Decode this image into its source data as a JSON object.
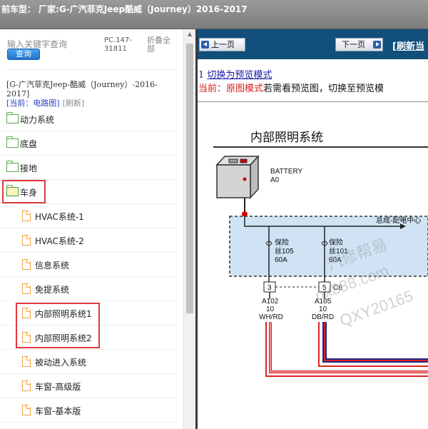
{
  "header": {
    "title": "前车型：  厂家:G-广汽菲克Jeep酷威（Journey）2016-2017"
  },
  "sidebar": {
    "search_placeholder": "输入关键字查询",
    "search_button": "查询",
    "pc_code": "PC.147-31811",
    "collapse_all": "折叠全部",
    "vehicle": "[G-广汽菲克Jeep-酷威（Journey）-2016-2017]",
    "current_label": "[当前：电路图]",
    "refresh_label": "[刷新]",
    "items": [
      {
        "label": "动力系统",
        "type": "folder"
      },
      {
        "label": "底盘",
        "type": "folder"
      },
      {
        "label": "接地",
        "type": "folder"
      },
      {
        "label": "车身",
        "type": "folder-open"
      },
      {
        "label": "HVAC系统-1",
        "type": "doc"
      },
      {
        "label": "HVAC系统-2",
        "type": "doc"
      },
      {
        "label": "信息系统",
        "type": "doc"
      },
      {
        "label": "免提系统",
        "type": "doc"
      },
      {
        "label": "内部照明系统1",
        "type": "doc"
      },
      {
        "label": "内部照明系统2",
        "type": "doc"
      },
      {
        "label": "被动进入系统",
        "type": "doc"
      },
      {
        "label": "车窗-高级版",
        "type": "doc"
      },
      {
        "label": "车窗-基本版",
        "type": "doc"
      }
    ]
  },
  "viewer": {
    "prev_button": "上一页",
    "next_button": "下一页",
    "refresh_link": "[刷新当",
    "switch_prefix": "1 ",
    "switch_link": "切换为预览模式",
    "mode_current": "当前：原图模式",
    "mode_hint": "若需看预览图，切换至预览模",
    "diagram": {
      "title": "内部照明系统",
      "battery_label": "BATTERY",
      "battery_code": "A0",
      "pdc_label": "总成-配电中心",
      "fuse1_line1": "保险",
      "fuse1_line2": "丝105",
      "fuse1_amp": "60A",
      "fuse2_line1": "保险",
      "fuse2_line2": "丝101",
      "fuse2_amp": "60A",
      "pin1": "3",
      "pin2": "5",
      "connector": "C6",
      "wire1_code": "A102",
      "wire1_gauge": "10",
      "wire1_color": "WH/RD",
      "wire2_code": "A105",
      "wire2_gauge": "10",
      "wire2_color": "DB/RD",
      "watermark1": "汽修帮易",
      "watermark2": "qx888.com",
      "watermark3": "QXY20165"
    }
  },
  "colors": {
    "nav_bg": "#124f7b",
    "highlight": "#e0393e",
    "mode_red": "#d21e1e",
    "pdc_fill": "#cfe3f5",
    "wire_blue": "#1a2a8a"
  }
}
